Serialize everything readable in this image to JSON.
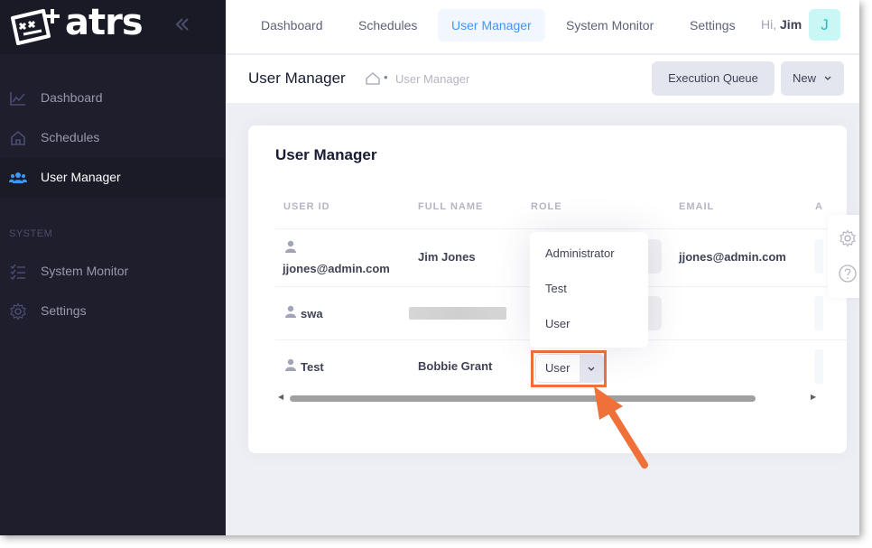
{
  "brand": {
    "name": "atrs"
  },
  "sidebar": {
    "items": [
      {
        "label": "Dashboard",
        "icon": "chart-line-icon"
      },
      {
        "label": "Schedules",
        "icon": "home-icon"
      },
      {
        "label": "User Manager",
        "icon": "users-icon",
        "active": true
      }
    ],
    "section_system": "SYSTEM",
    "system_items": [
      {
        "label": "System Monitor",
        "icon": "list-check-icon"
      },
      {
        "label": "Settings",
        "icon": "gear-icon"
      }
    ]
  },
  "header": {
    "tabs": [
      {
        "label": "Dashboard"
      },
      {
        "label": "Schedules"
      },
      {
        "label": "User Manager",
        "active": true
      },
      {
        "label": "System Monitor"
      },
      {
        "label": "Settings"
      }
    ],
    "greeting_prefix": "Hi,",
    "user_name": "Jim",
    "avatar_letter": "J"
  },
  "toolbar": {
    "title": "User Manager",
    "breadcrumb": "User Manager",
    "execution_queue_label": "Execution Queue",
    "new_label": "New"
  },
  "card": {
    "title": "User Manager",
    "columns": [
      "USER ID",
      "FULL NAME",
      "ROLE",
      "EMAIL",
      "A"
    ],
    "rows": [
      {
        "user_id": "jjones@admin.com",
        "full_name": "Jim Jones",
        "role": "",
        "email": "jjones@admin.com"
      },
      {
        "user_id": "swa",
        "full_name": "",
        "role": "",
        "email": ""
      },
      {
        "user_id": "Test",
        "full_name": "Bobbie Grant",
        "role": "User",
        "email": ""
      }
    ]
  },
  "role_dropdown": {
    "options": [
      "Administrator",
      "Test",
      "User"
    ]
  },
  "colors": {
    "accent": "#3e97ff",
    "sidebar_bg": "#1e1e2d",
    "highlight": "#f0703a"
  }
}
